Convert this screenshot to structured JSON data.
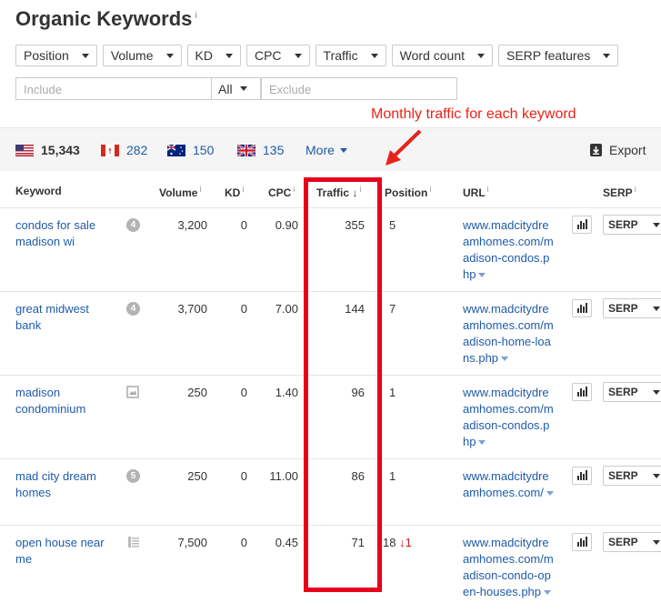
{
  "page": {
    "title": "Organic Keywords",
    "info_mark": "i"
  },
  "filters": [
    "Position",
    "Volume",
    "KD",
    "CPC",
    "Traffic",
    "Word count",
    "SERP features"
  ],
  "search": {
    "include_placeholder": "Include",
    "mode_value": "All",
    "exclude_placeholder": "Exclude"
  },
  "annotation": "Monthly traffic for each keyword",
  "countries": [
    {
      "flag": "us-flag-icon",
      "count": "15,343"
    },
    {
      "flag": "ca-flag-icon",
      "count": "282"
    },
    {
      "flag": "au-flag-icon",
      "count": "150"
    },
    {
      "flag": "uk-flag-icon",
      "count": "135"
    }
  ],
  "more_label": "More",
  "export_label": "Export",
  "columns": {
    "keyword": "Keyword",
    "volume": "Volume",
    "kd": "KD",
    "cpc": "CPC",
    "traffic": "Traffic",
    "traffic_sort": "↓",
    "position": "Position",
    "url": "URL",
    "serp": "SERP"
  },
  "rows": [
    {
      "keyword": "condos for sale madison wi",
      "badge": "4",
      "feature": "badge",
      "volume": "3,200",
      "kd": "0",
      "cpc": "0.90",
      "traffic": "355",
      "position": "5",
      "position_change": "",
      "url": "www.madcitydreamhomes.com/madison-condos.php",
      "serp": "SERP"
    },
    {
      "keyword": "great midwest bank",
      "badge": "4",
      "feature": "badge",
      "volume": "3,700",
      "kd": "0",
      "cpc": "7.00",
      "traffic": "144",
      "position": "7",
      "position_change": "",
      "url": "www.madcitydreamhomes.com/madison-home-loans.php",
      "serp": "SERP"
    },
    {
      "keyword": "madison condominium",
      "badge": "",
      "feature": "image-icon",
      "volume": "250",
      "kd": "0",
      "cpc": "1.40",
      "traffic": "96",
      "position": "1",
      "position_change": "",
      "url": "www.madcitydreamhomes.com/madison-condos.php",
      "serp": "SERP"
    },
    {
      "keyword": "mad city dream homes",
      "badge": "5",
      "feature": "badge",
      "volume": "250",
      "kd": "0",
      "cpc": "11.00",
      "traffic": "86",
      "position": "1",
      "position_change": "",
      "url": "www.madcitydreamhomes.com/",
      "serp": "SERP"
    },
    {
      "keyword": "open house near me",
      "badge": "",
      "feature": "list-icon",
      "volume": "7,500",
      "kd": "0",
      "cpc": "0.45",
      "traffic": "71",
      "position": "18",
      "position_change": "↓1",
      "url": "www.madcitydreamhomes.com/madison-condo-open-houses.php",
      "serp": "SERP"
    }
  ],
  "colors": {
    "link": "#1f5ba8",
    "highlight": "#e8001c",
    "annotation": "#e8231a"
  }
}
